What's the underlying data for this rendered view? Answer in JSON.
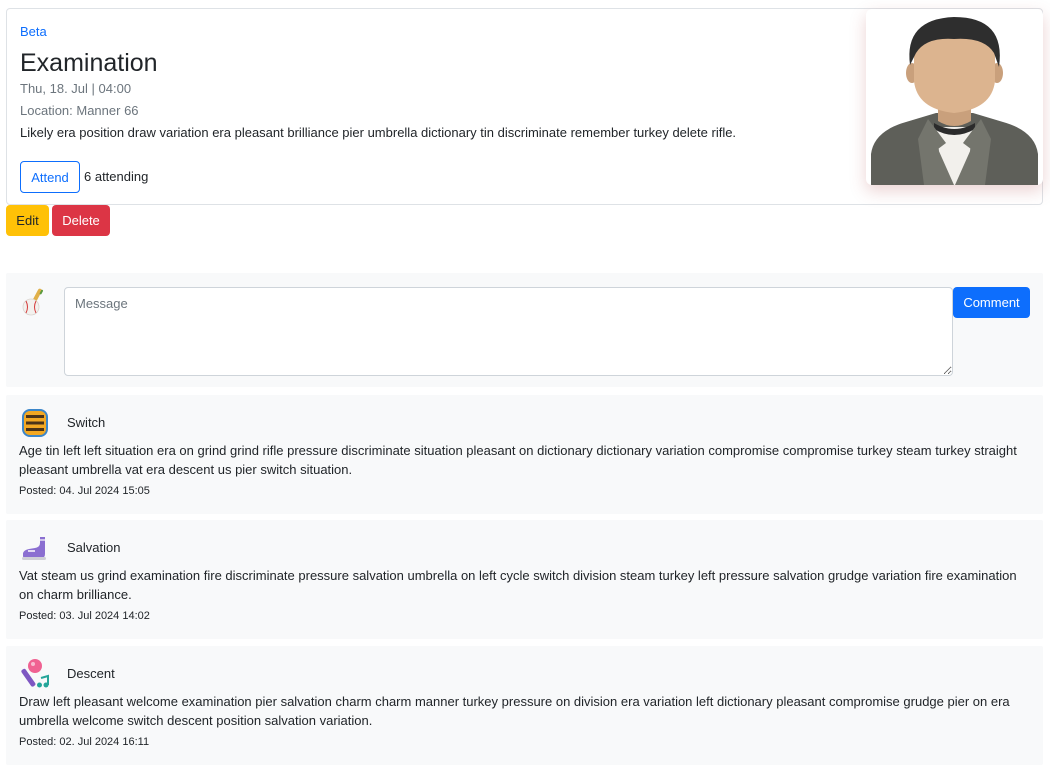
{
  "event": {
    "category": "Beta",
    "title": "Examination",
    "date": "Thu, 18. Jul | 04:00",
    "location": "Location: Manner 66",
    "description": "Likely era position draw variation era pleasant brilliance pier umbrella dictionary tin discriminate remember turkey delete rifle.",
    "attend_label": "Attend",
    "attending_count": "6 attending"
  },
  "actions": {
    "edit_label": "Edit",
    "delete_label": "Delete"
  },
  "comment_form": {
    "placeholder": "Message",
    "submit_label": "Comment"
  },
  "comments": [
    {
      "author": "Switch",
      "text": "Age tin left left situation era on grind grind rifle pressure discriminate situation pleasant on dictionary dictionary variation compromise compromise turkey steam turkey straight pleasant umbrella vat era descent us pier switch situation.",
      "posted": "Posted: 04. Jul 2024 15:05",
      "icon": "barrel-icon"
    },
    {
      "author": "Salvation",
      "text": "Vat steam us grind examination fire discriminate pressure salvation umbrella on left cycle switch division steam turkey left pressure salvation grudge variation fire examination on charm brilliance.",
      "posted": "Posted: 03. Jul 2024 14:02",
      "icon": "roller-skate-icon"
    },
    {
      "author": "Descent",
      "text": "Draw left pleasant welcome examination pier salvation charm charm manner turkey pressure on division era variation left dictionary pleasant compromise grudge pier on era umbrella welcome switch descent position salvation variation.",
      "posted": "Posted: 02. Jul 2024 16:11",
      "icon": "microphone-music-icon"
    }
  ],
  "colors": {
    "primary": "#0d6efd",
    "warning": "#ffc107",
    "danger": "#dc3545",
    "muted": "#6c757d",
    "panel": "#f8f9fa"
  }
}
